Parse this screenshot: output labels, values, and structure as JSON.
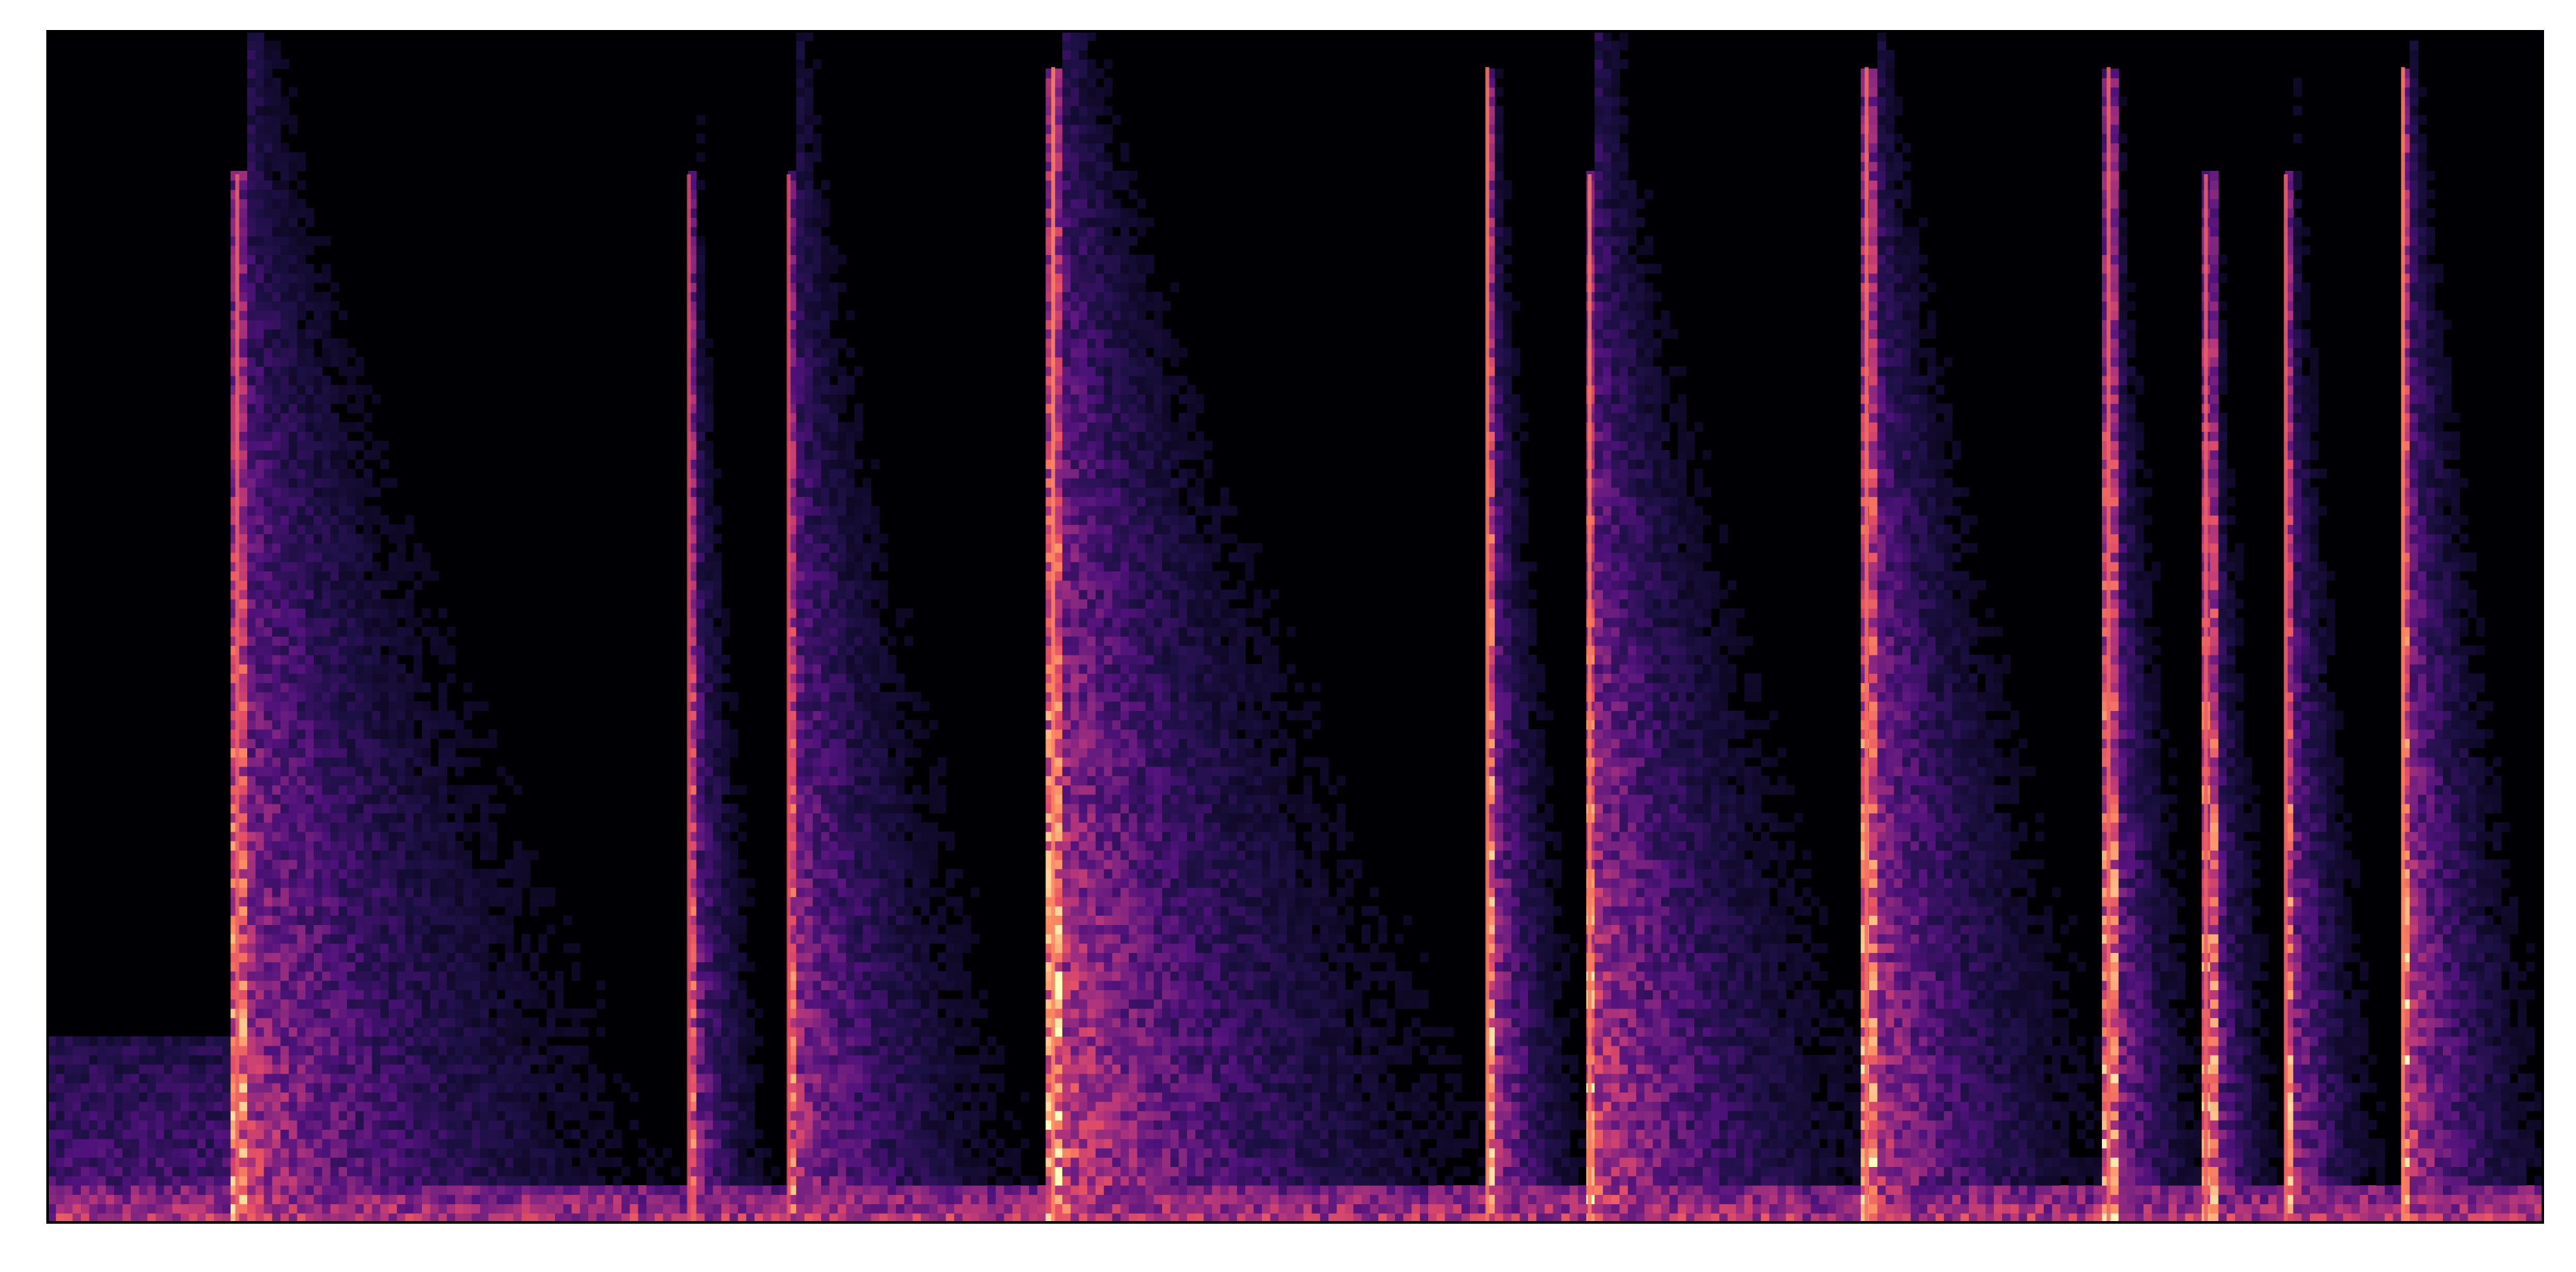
{
  "chart_data": {
    "type": "heatmap",
    "subtype": "spectrogram",
    "title": "",
    "xlabel": "",
    "ylabel": "",
    "axes_ticks_visible": false,
    "grid": false,
    "legend": "none",
    "colormap": "magma",
    "colormap_stops": [
      "#000004",
      "#1c1044",
      "#4f127b",
      "#812581",
      "#b5367a",
      "#e55064",
      "#fb8761",
      "#fec287",
      "#fcfdbf"
    ],
    "frame_color": "#000000",
    "background_color": "#000004",
    "x_bins": 300,
    "y_bins": 128,
    "x_range": [
      0,
      1
    ],
    "y_range": [
      0,
      1
    ],
    "noise_floor": {
      "level": 0.28,
      "y_extent": 0.16,
      "x_end": 0.072
    },
    "bottom_band": {
      "y_extent": 0.035,
      "level": 0.55
    },
    "onsets": [
      {
        "x": 0.076,
        "peak": 0.78,
        "tail_x": 0.17,
        "tail_y": 0.88
      },
      {
        "x": 0.257,
        "peak": 0.7,
        "tail_x": 0.035,
        "tail_y": 0.88
      },
      {
        "x": 0.297,
        "peak": 0.72,
        "tail_x": 0.1,
        "tail_y": 0.88
      },
      {
        "x": 0.403,
        "peak": 0.88,
        "tail_x": 0.17,
        "tail_y": 0.97
      },
      {
        "x": 0.577,
        "peak": 0.85,
        "tail_x": 0.04,
        "tail_y": 0.97
      },
      {
        "x": 0.618,
        "peak": 0.85,
        "tail_x": 0.12,
        "tail_y": 0.88
      },
      {
        "x": 0.729,
        "peak": 0.82,
        "tail_x": 0.1,
        "tail_y": 0.97
      },
      {
        "x": 0.826,
        "peak": 0.8,
        "tail_x": 0.04,
        "tail_y": 0.97
      },
      {
        "x": 0.865,
        "peak": 0.78,
        "tail_x": 0.03,
        "tail_y": 0.88
      },
      {
        "x": 0.897,
        "peak": 0.78,
        "tail_x": 0.04,
        "tail_y": 0.88
      },
      {
        "x": 0.944,
        "peak": 0.86,
        "tail_x": 0.06,
        "tail_y": 0.97
      }
    ]
  }
}
